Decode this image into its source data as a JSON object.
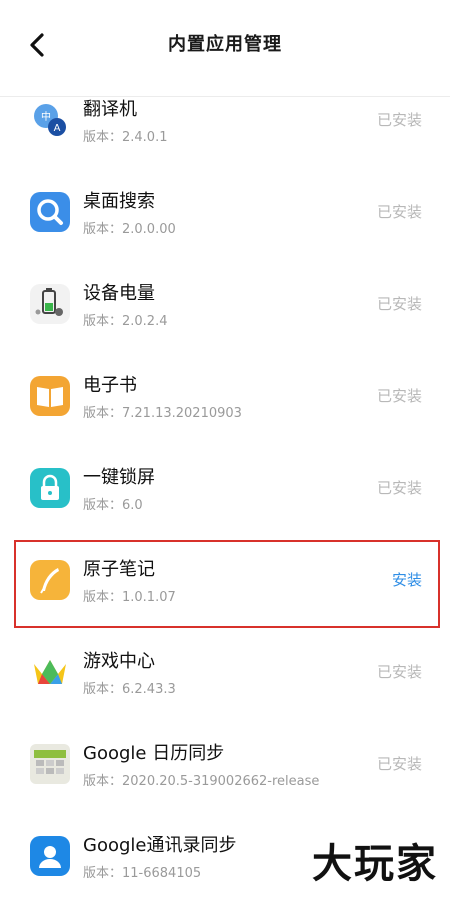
{
  "header": {
    "title": "内置应用管理"
  },
  "apps": [
    {
      "name": "翻译机",
      "version": "版本：2.4.0.1",
      "action": "已安装",
      "icon": "translate-icon"
    },
    {
      "name": "桌面搜索",
      "version": "版本：2.0.0.00",
      "action": "已安装",
      "icon": "search-icon"
    },
    {
      "name": "设备电量",
      "version": "版本：2.0.2.4",
      "action": "已安装",
      "icon": "battery-icon"
    },
    {
      "name": "电子书",
      "version": "版本：7.21.13.20210903",
      "action": "已安装",
      "icon": "book-icon"
    },
    {
      "name": "一键锁屏",
      "version": "版本：6.0",
      "action": "已安装",
      "icon": "lock-icon"
    },
    {
      "name": "原子笔记",
      "version": "版本：1.0.1.07",
      "action": "安装",
      "icon": "note-icon"
    },
    {
      "name": "游戏中心",
      "version": "版本：6.2.43.3",
      "action": "已安装",
      "icon": "game-center-icon"
    },
    {
      "name": "Google 日历同步",
      "version": "版本：2020.20.5-319002662-release",
      "action": "已安装",
      "icon": "calendar-icon"
    },
    {
      "name": "Google通讯录同步",
      "version": "版本：11-6684105",
      "action": "",
      "icon": "contacts-icon"
    }
  ],
  "watermark": "大玩家",
  "colors": {
    "install": "#2f8ee6",
    "installed": "#b8b8b8",
    "highlight": "#d8312b"
  }
}
